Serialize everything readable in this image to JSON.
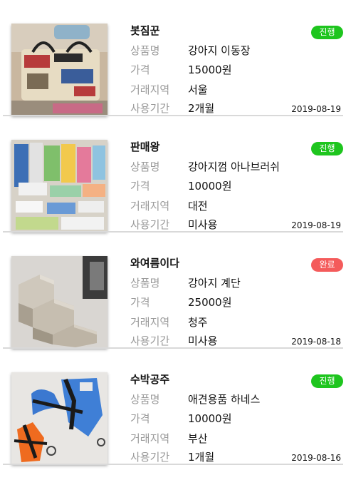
{
  "labels": {
    "product": "상품명",
    "price": "가격",
    "region": "거래지역",
    "period": "사용기간"
  },
  "items": [
    {
      "title": "봇짐꾼",
      "status": "진행",
      "product": "강아지 이동장",
      "price": "15000원",
      "region": "서울",
      "period": "2개월",
      "date": "2019-08-19",
      "image": "pet-carrier-bag"
    },
    {
      "title": "판매왕",
      "status": "진행",
      "product": "강아지껌 아나브러쉬",
      "price": "10000원",
      "region": "대전",
      "period": "미사용",
      "date": "2019-08-19",
      "image": "dog-chew-packs"
    },
    {
      "title": "와여름이다",
      "status": "완료",
      "product": "강아지 계단",
      "price": "25000원",
      "region": "청주",
      "period": "미사용",
      "date": "2019-08-18",
      "image": "dog-stairs"
    },
    {
      "title": "수박공주",
      "status": "진행",
      "product": "애견용품 하네스",
      "price": "10000원",
      "region": "부산",
      "period": "1개월",
      "date": "2019-08-16",
      "image": "dog-harness"
    }
  ],
  "colors": {
    "status_progress": "#1ec51e",
    "status_done": "#f45b5b",
    "label_gray": "#9a9a9a",
    "divider": "#d9d9d9"
  }
}
